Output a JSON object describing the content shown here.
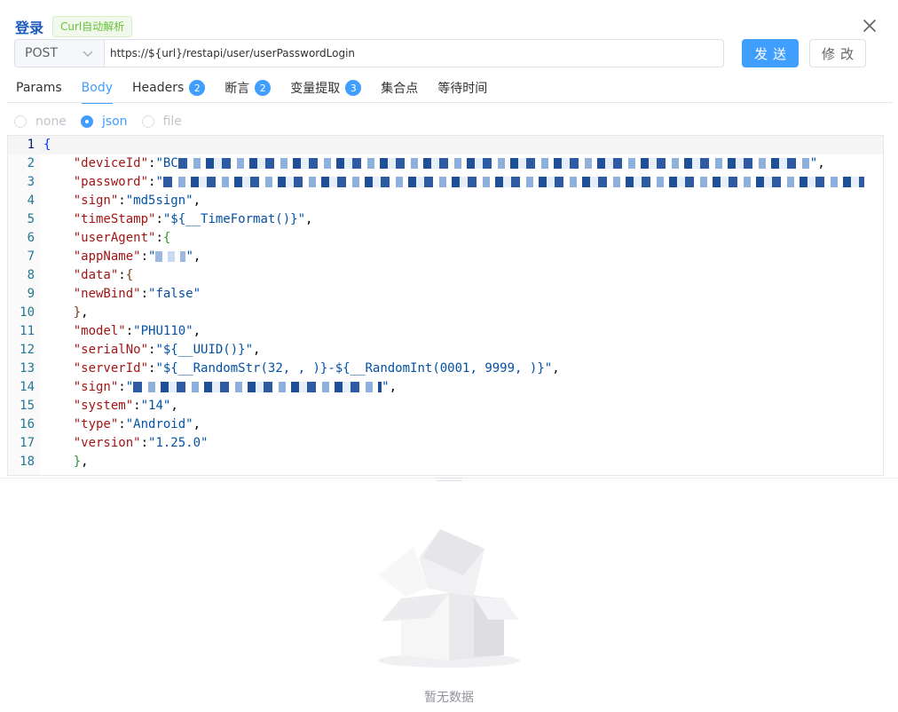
{
  "header": {
    "title": "登录",
    "curl_tag": "Curl自动解析",
    "close_icon": "close-icon"
  },
  "request": {
    "method": "POST",
    "url": "https://${url}/restapi/user/userPasswordLogin",
    "send_label": "发送",
    "edit_label": "修改"
  },
  "tabs": [
    {
      "label": "Params",
      "badge": null,
      "active": false
    },
    {
      "label": "Body",
      "badge": null,
      "active": true
    },
    {
      "label": "Headers",
      "badge": "2",
      "active": false
    },
    {
      "label": "断言",
      "badge": "2",
      "active": false
    },
    {
      "label": "变量提取",
      "badge": "3",
      "active": false
    },
    {
      "label": "集合点",
      "badge": null,
      "active": false
    },
    {
      "label": "等待时间",
      "badge": null,
      "active": false
    }
  ],
  "body_types": [
    {
      "label": "none",
      "checked": false
    },
    {
      "label": "json",
      "checked": true
    },
    {
      "label": "file",
      "checked": false
    }
  ],
  "editor": {
    "line_numbers": [
      "1",
      "2",
      "3",
      "4",
      "5",
      "6",
      "7",
      "8",
      "9",
      "10",
      "11",
      "12",
      "13",
      "14",
      "15",
      "16",
      "17",
      "18"
    ],
    "lines": {
      "l2_key": "\"deviceId\"",
      "l2_val": "\"BC",
      "l3_key": "\"password\"",
      "l3_val": "\"",
      "l4_key": "\"sign\"",
      "l4_val": "\"md5sign\"",
      "l5_key": "\"timeStamp\"",
      "l5_val": "\"${__TimeFormat()}\"",
      "l6_key": "\"userAgent\"",
      "l7_key": "\"appName\"",
      "l7_val": "\"",
      "l8_key": "\"data\"",
      "l9_key": "\"newBind\"",
      "l9_val": "\"false\"",
      "l11_key": "\"model\"",
      "l11_val": "\"PHU110\"",
      "l12_key": "\"serialNo\"",
      "l12_val": "\"${__UUID()}\"",
      "l13_key": "\"serverId\"",
      "l13_val": "\"${__RandomStr(32, , )}-${__RandomInt(0001, 9999, )}\"",
      "l14_key": "\"sign\"",
      "l14_val": "\"",
      "l15_key": "\"system\"",
      "l15_val": "\"14\"",
      "l16_key": "\"type\"",
      "l16_val": "\"Android\"",
      "l17_key": "\"version\"",
      "l17_val": "\"1.25.0\""
    }
  },
  "response": {
    "empty_text": "暂无数据",
    "empty_icon": "empty-box-icon"
  },
  "colors": {
    "accent": "#409eff",
    "title": "#1e5bbd",
    "tag_green": "#67c23a"
  }
}
